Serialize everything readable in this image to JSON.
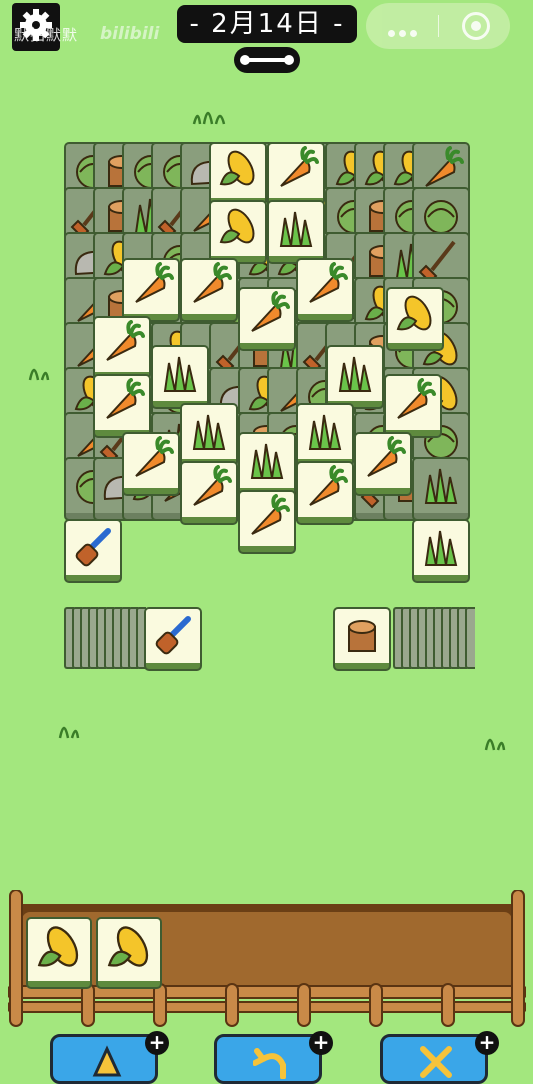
{
  "header": {
    "date_label": "- 2月14日 -",
    "watermark": "默拍默默",
    "watermark_brand": "bilibili"
  },
  "colors": {
    "background": "#a3e77e",
    "tile_face": "#fafadf",
    "tile_shadow_dark": "#3f5c31",
    "button_blue": "#3aa6e8",
    "fence_brown": "#8b5a2b",
    "slot_brown": "#a0692e"
  },
  "board": {
    "tile_types": [
      "carrot",
      "corn",
      "grass",
      "cabbage",
      "stump",
      "rock",
      "shovel",
      "brush",
      "rake"
    ],
    "covered_tile_icons": "mixed"
  },
  "left_pile": {
    "top_icon": "brush",
    "remaining_cards": 10
  },
  "right_pile": {
    "top_icon": "stump",
    "remaining_cards": 10
  },
  "slot_bar": {
    "capacity": 7,
    "tiles": [
      "corn",
      "corn"
    ]
  },
  "buttons": [
    {
      "name": "shuffle-out-button",
      "icon": "shuffle-out-icon",
      "badge": "+"
    },
    {
      "name": "undo-button",
      "icon": "undo-icon",
      "badge": "+"
    },
    {
      "name": "shuffle-button",
      "icon": "shuffle-icon",
      "badge": "+"
    }
  ]
}
